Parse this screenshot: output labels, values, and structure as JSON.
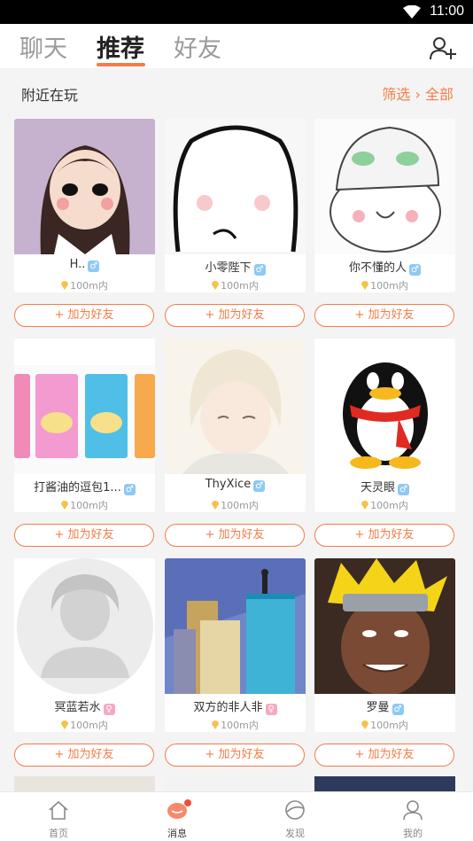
{
  "status": {
    "time": "11:00"
  },
  "tabs": [
    {
      "label": "聊天"
    },
    {
      "label": "推荐"
    },
    {
      "label": "好友"
    }
  ],
  "section": {
    "title": "附近在玩",
    "filter": "筛选 › 全部"
  },
  "users": [
    {
      "name": "H..",
      "gender": "male",
      "distance": "100m内"
    },
    {
      "name": "小零陛下",
      "gender": "male",
      "distance": "100m内"
    },
    {
      "name": "你不懂的人",
      "gender": "male",
      "distance": "100m内"
    },
    {
      "name": "打酱油的逗包1...",
      "gender": "male",
      "distance": "100m内"
    },
    {
      "name": "ThyXice",
      "gender": "male",
      "distance": "100m内"
    },
    {
      "name": "天灵眼",
      "gender": "male",
      "distance": "100m内"
    },
    {
      "name": "冥蓝若水",
      "gender": "female",
      "distance": "100m内"
    },
    {
      "name": "双方的非人非",
      "gender": "female",
      "distance": "100m内"
    },
    {
      "name": "罗曼",
      "gender": "male",
      "distance": "100m内"
    }
  ],
  "add_friend_label": "+ 加为好友",
  "nav": [
    {
      "label": "首页",
      "icon": "home-icon"
    },
    {
      "label": "消息",
      "icon": "message-icon"
    },
    {
      "label": "发现",
      "icon": "discover-icon"
    },
    {
      "label": "我的",
      "icon": "profile-icon"
    }
  ],
  "colors": {
    "accent": "#f47c48",
    "male": "#8ec9f5",
    "female": "#f6a8c4",
    "badge": "#f24c3c"
  }
}
